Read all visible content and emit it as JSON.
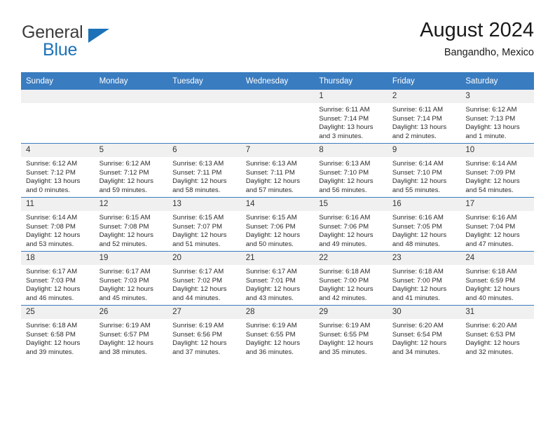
{
  "brand": {
    "logo_text_primary": "General",
    "logo_text_secondary": "Blue",
    "accent_color": "#1b72b8",
    "header_color": "#3a7cc0"
  },
  "header": {
    "title": "August 2024",
    "subtitle": "Bangandho, Mexico"
  },
  "weekday_headers": [
    "Sunday",
    "Monday",
    "Tuesday",
    "Wednesday",
    "Thursday",
    "Friday",
    "Saturday"
  ],
  "labels": {
    "sunrise": "Sunrise:",
    "sunset": "Sunset:",
    "daylight": "Daylight:"
  },
  "weeks": [
    [
      {
        "day": "",
        "blank": true
      },
      {
        "day": "",
        "blank": true
      },
      {
        "day": "",
        "blank": true
      },
      {
        "day": "",
        "blank": true
      },
      {
        "day": "1",
        "sunrise": "Sunrise: 6:11 AM",
        "sunset": "Sunset: 7:14 PM",
        "daylight": "Daylight: 13 hours and 3 minutes."
      },
      {
        "day": "2",
        "sunrise": "Sunrise: 6:11 AM",
        "sunset": "Sunset: 7:14 PM",
        "daylight": "Daylight: 13 hours and 2 minutes."
      },
      {
        "day": "3",
        "sunrise": "Sunrise: 6:12 AM",
        "sunset": "Sunset: 7:13 PM",
        "daylight": "Daylight: 13 hours and 1 minute."
      }
    ],
    [
      {
        "day": "4",
        "sunrise": "Sunrise: 6:12 AM",
        "sunset": "Sunset: 7:12 PM",
        "daylight": "Daylight: 13 hours and 0 minutes."
      },
      {
        "day": "5",
        "sunrise": "Sunrise: 6:12 AM",
        "sunset": "Sunset: 7:12 PM",
        "daylight": "Daylight: 12 hours and 59 minutes."
      },
      {
        "day": "6",
        "sunrise": "Sunrise: 6:13 AM",
        "sunset": "Sunset: 7:11 PM",
        "daylight": "Daylight: 12 hours and 58 minutes."
      },
      {
        "day": "7",
        "sunrise": "Sunrise: 6:13 AM",
        "sunset": "Sunset: 7:11 PM",
        "daylight": "Daylight: 12 hours and 57 minutes."
      },
      {
        "day": "8",
        "sunrise": "Sunrise: 6:13 AM",
        "sunset": "Sunset: 7:10 PM",
        "daylight": "Daylight: 12 hours and 56 minutes."
      },
      {
        "day": "9",
        "sunrise": "Sunrise: 6:14 AM",
        "sunset": "Sunset: 7:10 PM",
        "daylight": "Daylight: 12 hours and 55 minutes."
      },
      {
        "day": "10",
        "sunrise": "Sunrise: 6:14 AM",
        "sunset": "Sunset: 7:09 PM",
        "daylight": "Daylight: 12 hours and 54 minutes."
      }
    ],
    [
      {
        "day": "11",
        "sunrise": "Sunrise: 6:14 AM",
        "sunset": "Sunset: 7:08 PM",
        "daylight": "Daylight: 12 hours and 53 minutes."
      },
      {
        "day": "12",
        "sunrise": "Sunrise: 6:15 AM",
        "sunset": "Sunset: 7:08 PM",
        "daylight": "Daylight: 12 hours and 52 minutes."
      },
      {
        "day": "13",
        "sunrise": "Sunrise: 6:15 AM",
        "sunset": "Sunset: 7:07 PM",
        "daylight": "Daylight: 12 hours and 51 minutes."
      },
      {
        "day": "14",
        "sunrise": "Sunrise: 6:15 AM",
        "sunset": "Sunset: 7:06 PM",
        "daylight": "Daylight: 12 hours and 50 minutes."
      },
      {
        "day": "15",
        "sunrise": "Sunrise: 6:16 AM",
        "sunset": "Sunset: 7:06 PM",
        "daylight": "Daylight: 12 hours and 49 minutes."
      },
      {
        "day": "16",
        "sunrise": "Sunrise: 6:16 AM",
        "sunset": "Sunset: 7:05 PM",
        "daylight": "Daylight: 12 hours and 48 minutes."
      },
      {
        "day": "17",
        "sunrise": "Sunrise: 6:16 AM",
        "sunset": "Sunset: 7:04 PM",
        "daylight": "Daylight: 12 hours and 47 minutes."
      }
    ],
    [
      {
        "day": "18",
        "sunrise": "Sunrise: 6:17 AM",
        "sunset": "Sunset: 7:03 PM",
        "daylight": "Daylight: 12 hours and 46 minutes."
      },
      {
        "day": "19",
        "sunrise": "Sunrise: 6:17 AM",
        "sunset": "Sunset: 7:03 PM",
        "daylight": "Daylight: 12 hours and 45 minutes."
      },
      {
        "day": "20",
        "sunrise": "Sunrise: 6:17 AM",
        "sunset": "Sunset: 7:02 PM",
        "daylight": "Daylight: 12 hours and 44 minutes."
      },
      {
        "day": "21",
        "sunrise": "Sunrise: 6:17 AM",
        "sunset": "Sunset: 7:01 PM",
        "daylight": "Daylight: 12 hours and 43 minutes."
      },
      {
        "day": "22",
        "sunrise": "Sunrise: 6:18 AM",
        "sunset": "Sunset: 7:00 PM",
        "daylight": "Daylight: 12 hours and 42 minutes."
      },
      {
        "day": "23",
        "sunrise": "Sunrise: 6:18 AM",
        "sunset": "Sunset: 7:00 PM",
        "daylight": "Daylight: 12 hours and 41 minutes."
      },
      {
        "day": "24",
        "sunrise": "Sunrise: 6:18 AM",
        "sunset": "Sunset: 6:59 PM",
        "daylight": "Daylight: 12 hours and 40 minutes."
      }
    ],
    [
      {
        "day": "25",
        "sunrise": "Sunrise: 6:18 AM",
        "sunset": "Sunset: 6:58 PM",
        "daylight": "Daylight: 12 hours and 39 minutes."
      },
      {
        "day": "26",
        "sunrise": "Sunrise: 6:19 AM",
        "sunset": "Sunset: 6:57 PM",
        "daylight": "Daylight: 12 hours and 38 minutes."
      },
      {
        "day": "27",
        "sunrise": "Sunrise: 6:19 AM",
        "sunset": "Sunset: 6:56 PM",
        "daylight": "Daylight: 12 hours and 37 minutes."
      },
      {
        "day": "28",
        "sunrise": "Sunrise: 6:19 AM",
        "sunset": "Sunset: 6:55 PM",
        "daylight": "Daylight: 12 hours and 36 minutes."
      },
      {
        "day": "29",
        "sunrise": "Sunrise: 6:19 AM",
        "sunset": "Sunset: 6:55 PM",
        "daylight": "Daylight: 12 hours and 35 minutes."
      },
      {
        "day": "30",
        "sunrise": "Sunrise: 6:20 AM",
        "sunset": "Sunset: 6:54 PM",
        "daylight": "Daylight: 12 hours and 34 minutes."
      },
      {
        "day": "31",
        "sunrise": "Sunrise: 6:20 AM",
        "sunset": "Sunset: 6:53 PM",
        "daylight": "Daylight: 12 hours and 32 minutes."
      }
    ]
  ]
}
